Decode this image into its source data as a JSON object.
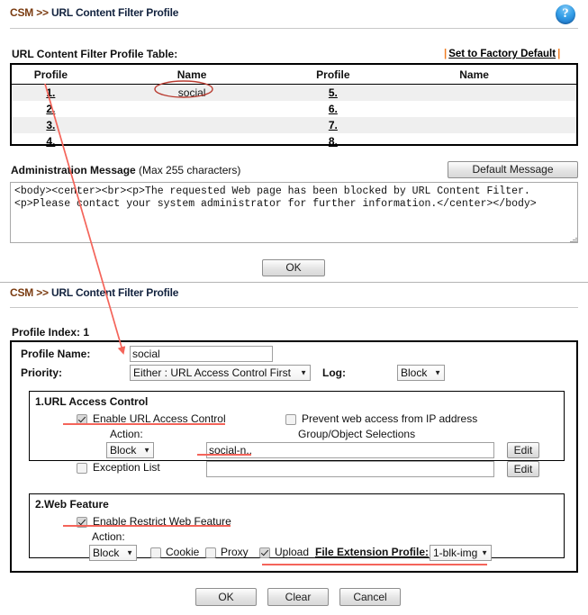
{
  "page": {
    "breadcrumb_csm": "CSM >>",
    "breadcrumb_page": "URL Content Filter Profile",
    "help_icon": "question-mark-icon"
  },
  "profile_table": {
    "section_label": "URL Content Filter Profile Table:",
    "factory_default_link": "Set to Factory Default",
    "factory_bar_left": "|",
    "factory_bar_right": "|",
    "headers": [
      "Profile",
      "Name",
      "Profile",
      "Name"
    ],
    "rows": [
      {
        "left_index": "1.",
        "left_name": "social",
        "right_index": "5.",
        "right_name": ""
      },
      {
        "left_index": "2.",
        "left_name": "",
        "right_index": "6.",
        "right_name": ""
      },
      {
        "left_index": "3.",
        "left_name": "",
        "right_index": "7.",
        "right_name": ""
      },
      {
        "left_index": "4.",
        "left_name": "",
        "right_index": "8.",
        "right_name": ""
      }
    ]
  },
  "admin_message": {
    "label_bold": "Administration Message",
    "label_note": " (Max 255 characters)",
    "default_button": "Default Message",
    "value": "<body><center><br><p>The requested Web page has been blocked by URL Content Filter.<p>Please contact your system administrator for further information.</center></body>",
    "ok_button": "OK"
  },
  "detail": {
    "breadcrumb_csm": "CSM >>",
    "breadcrumb_page": "URL Content Filter Profile",
    "profile_index_label": "Profile Index: 1",
    "profile_name_label": "Profile Name:",
    "profile_name_value": "social",
    "priority_label": "Priority:",
    "priority_value": "Either : URL Access Control First",
    "log_label": "Log:",
    "log_value": "Block",
    "url_access": {
      "title": "1.URL Access Control",
      "enable_label": "Enable URL Access Control",
      "enable_checked": true,
      "prevent_label": "Prevent web access from IP address",
      "prevent_checked": false,
      "action_label": "Action:",
      "group_label": "Group/Object Selections",
      "action_value": "Block",
      "group_value": "social-n..",
      "edit_button_1": "Edit",
      "exception_label": "Exception List",
      "exception_checked": false,
      "exception_value": "",
      "edit_button_2": "Edit"
    },
    "web_feature": {
      "title": "2.Web Feature",
      "enable_label": "Enable Restrict Web Feature",
      "enable_checked": true,
      "action_label": "Action:",
      "action_value": "Block",
      "cookie_label": "Cookie",
      "cookie_checked": false,
      "proxy_label": "Proxy",
      "proxy_checked": false,
      "upload_label": "Upload",
      "upload_checked": true,
      "file_ext_label": "File Extension Profile:",
      "file_ext_value": "1-blk-img"
    },
    "buttons": {
      "ok": "OK",
      "clear": "Clear",
      "cancel": "Cancel"
    }
  },
  "annotations": {
    "accent_red": "#f4645a",
    "arrow_color": "#f4645a",
    "ellipse_color": "#c0392b",
    "circled_text": "social",
    "arrow_from": "profile-1-link",
    "arrow_to": "profile-name-field"
  }
}
